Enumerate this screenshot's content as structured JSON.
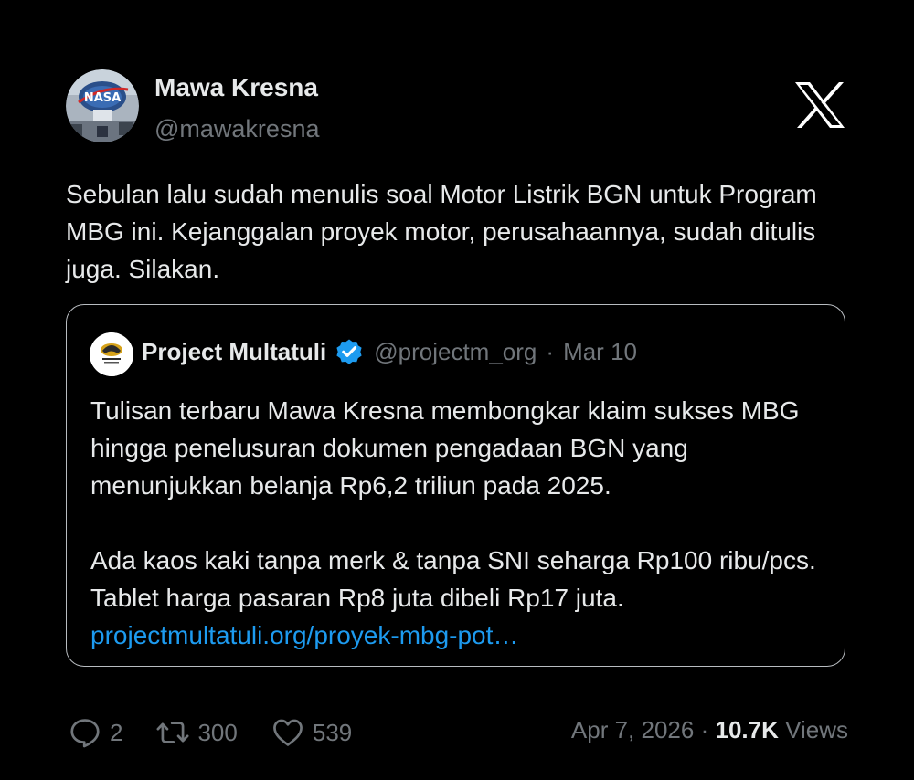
{
  "author": {
    "name": "Mawa Kresna",
    "handle": "@mawakresna"
  },
  "tweet": {
    "text": "Sebulan lalu sudah menulis soal Motor Listrik BGN untuk Program MBG ini. Kejanggalan proyek motor, perusahaannya, sudah ditulis juga. Silakan."
  },
  "quote": {
    "name": "Project Multatuli",
    "handle": "@projectm_org",
    "separator": "·",
    "date": "Mar 10",
    "paragraph1": "Tulisan terbaru Mawa Kresna membongkar klaim sukses MBG hingga penelusuran dokumen pengadaan BGN yang menunjukkan belanja Rp6,2 triliun pada 2025.",
    "paragraph2": "Ada kaos kaki tanpa merk & tanpa SNI seharga Rp100 ribu/pcs. Tablet harga pasaran Rp8 juta dibeli Rp17 juta.",
    "link": "projectmultatuli.org/proyek-mbg-pot…"
  },
  "actions": {
    "replies": "2",
    "retweets": "300",
    "likes": "539"
  },
  "meta": {
    "date": "Apr 7, 2026",
    "separator": "·",
    "views_count": "10.7K",
    "views_label": "Views"
  },
  "colors": {
    "background": "#000000",
    "text": "#e7e9ea",
    "secondary": "#71767b",
    "link": "#1d9bf0",
    "verified": "#1d9bf0"
  },
  "icons": {
    "logo": "x-logo-icon",
    "verified": "verified-badge-icon",
    "reply": "reply-icon",
    "retweet": "retweet-icon",
    "like": "heart-icon"
  }
}
